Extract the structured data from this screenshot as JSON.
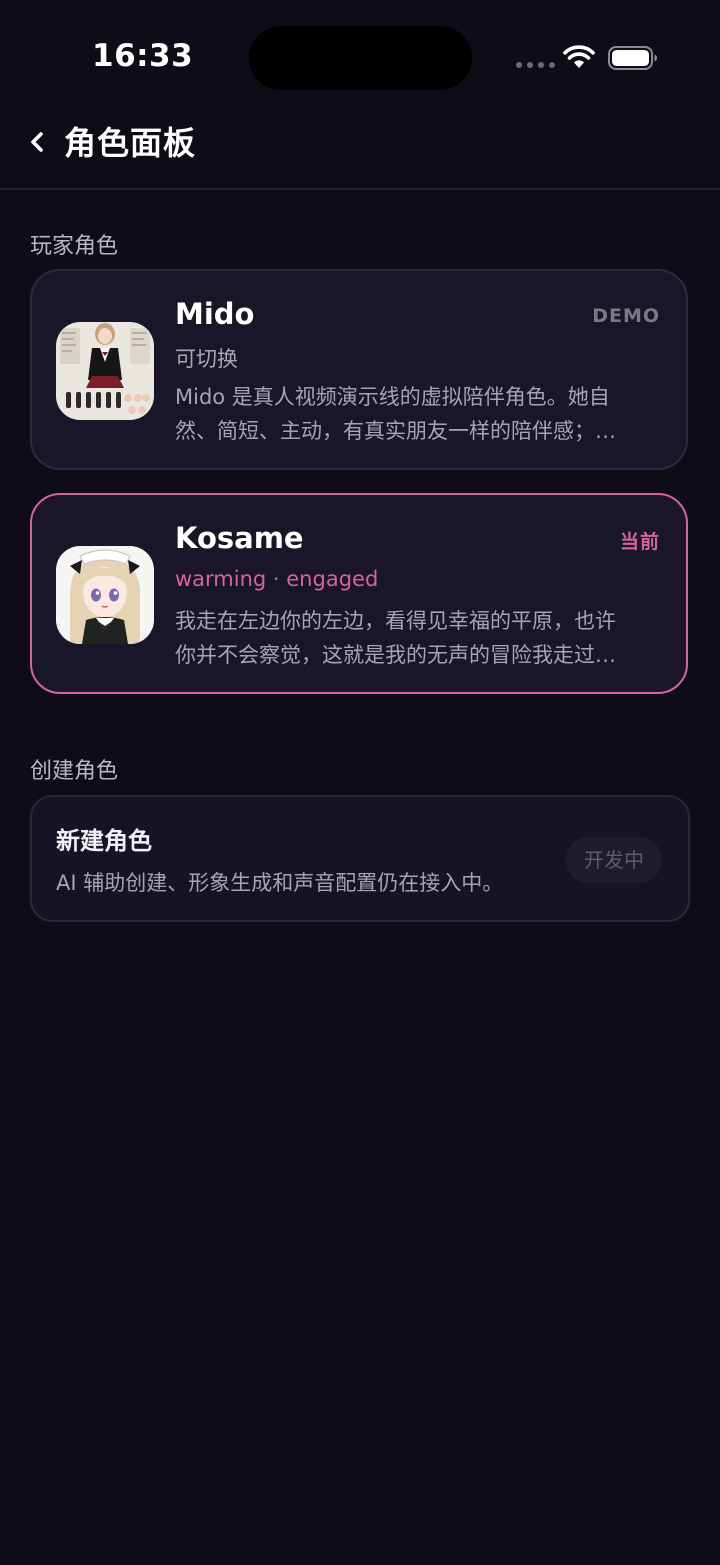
{
  "status_bar": {
    "time": "16:33"
  },
  "nav": {
    "title": "角色面板",
    "back_icon": "chevron-left-icon"
  },
  "sections": {
    "player_label": "玩家角色",
    "create_label": "创建角色"
  },
  "characters": [
    {
      "name": "Mido",
      "badge": "DEMO",
      "subtitle": "可切换",
      "description_lines": [
        "Mido 是真人视频演示线的虚拟陪伴角色。她自",
        "然、简短、主动，有真实朋友一样的陪伴感；…"
      ],
      "active": false
    },
    {
      "name": "Kosame",
      "badge": "当前",
      "subtitle": "warming · engaged",
      "description_lines": [
        "我走在左边你的左边，看得见幸福的平原，也许",
        "你并不会察觉，这就是我的无声的冒险我走过…"
      ],
      "active": true
    }
  ],
  "create": {
    "title": "新建角色",
    "description": "AI 辅助创建、形象生成和声音配置仍在接入中。",
    "status": "开发中"
  },
  "colors": {
    "background": "#0e0d17",
    "card": "#181628",
    "accent_pink": "#d5649d",
    "muted": "#a7a3b6"
  }
}
